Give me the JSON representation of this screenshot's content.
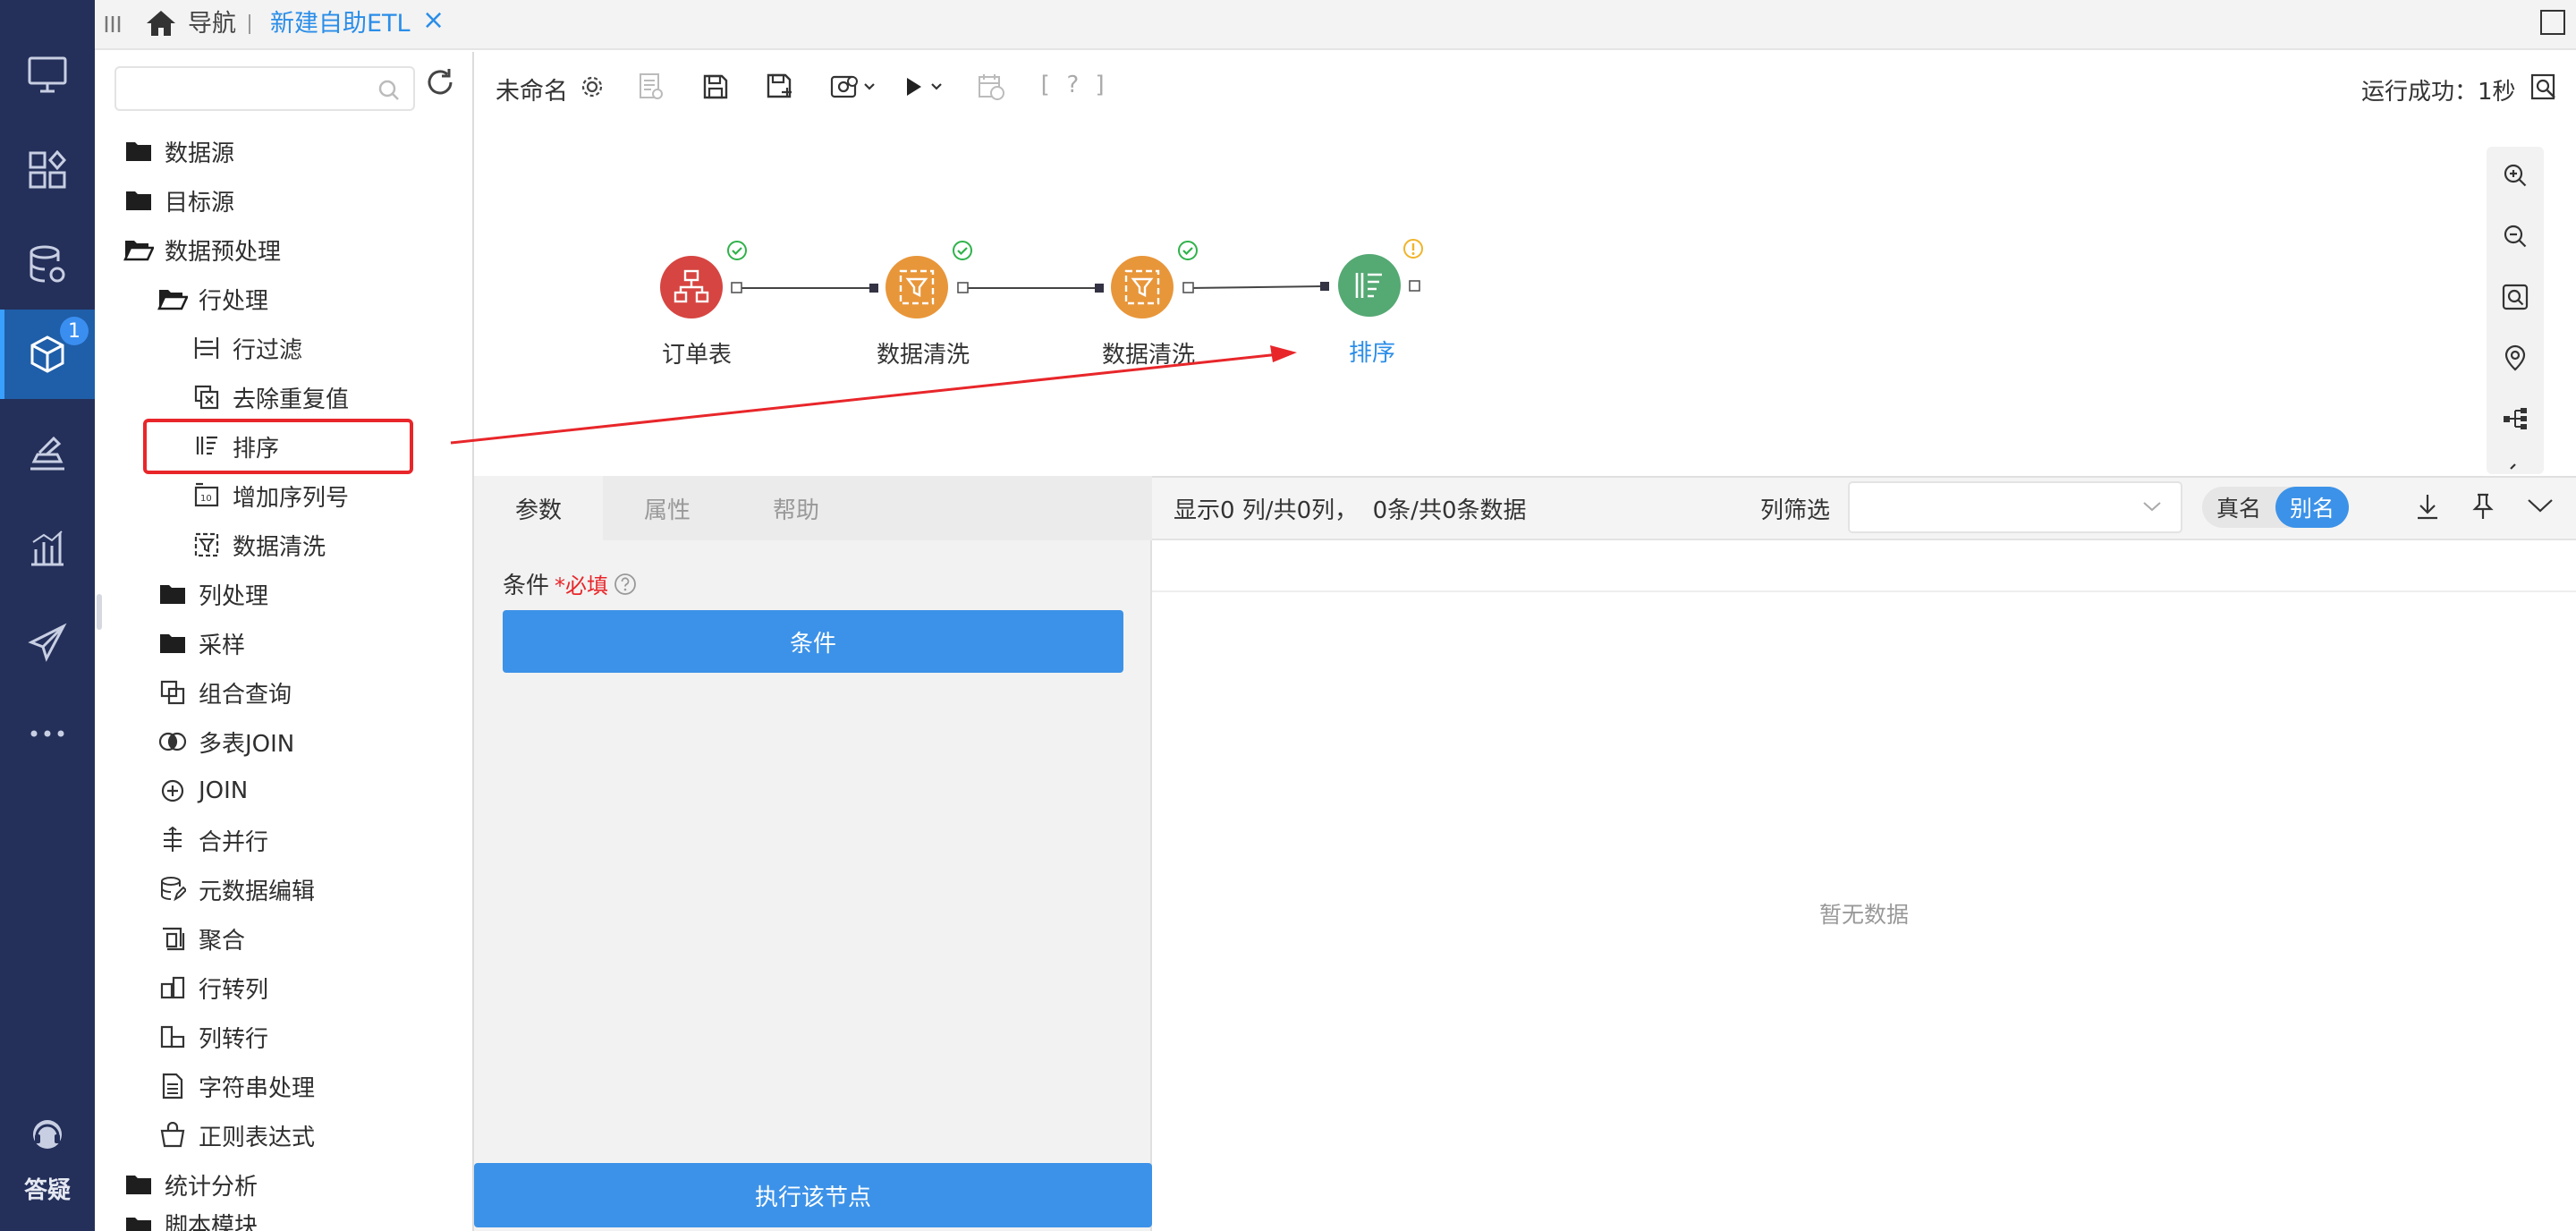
{
  "tabs": {
    "home_label": "导航",
    "active_tab": "新建自助ETL",
    "close_glyph": "×"
  },
  "rail": {
    "badge_count": "1",
    "help_label": "答疑",
    "items": [
      "monitor-icon",
      "dashboard-icon",
      "database-settings-icon",
      "etl-cube-icon",
      "analysis-icon",
      "bar-chart-icon",
      "send-icon",
      "more-icon"
    ]
  },
  "tree": {
    "search_placeholder": "",
    "items": [
      {
        "label": "数据源",
        "icon": "folder-icon"
      },
      {
        "label": "目标源",
        "icon": "folder-icon"
      },
      {
        "label": "数据预处理",
        "icon": "folder-open-icon"
      },
      {
        "label": "行处理",
        "icon": "folder-open-icon"
      },
      {
        "label": "行过滤",
        "icon": "row-filter-icon"
      },
      {
        "label": "去除重复值",
        "icon": "dedupe-icon"
      },
      {
        "label": "排序",
        "icon": "sort-icon"
      },
      {
        "label": "增加序列号",
        "icon": "serial-number-icon"
      },
      {
        "label": "数据清洗",
        "icon": "data-clean-icon"
      },
      {
        "label": "列处理",
        "icon": "folder-icon"
      },
      {
        "label": "采样",
        "icon": "folder-icon"
      },
      {
        "label": "组合查询",
        "icon": "combined-query-icon"
      },
      {
        "label": "多表JOIN",
        "icon": "multi-join-icon"
      },
      {
        "label": "JOIN",
        "icon": "join-icon"
      },
      {
        "label": "合并行",
        "icon": "merge-rows-icon"
      },
      {
        "label": "元数据编辑",
        "icon": "metadata-edit-icon"
      },
      {
        "label": "聚合",
        "icon": "aggregate-icon"
      },
      {
        "label": "行转列",
        "icon": "row-to-column-icon"
      },
      {
        "label": "列转行",
        "icon": "column-to-row-icon"
      },
      {
        "label": "字符串处理",
        "icon": "string-process-icon"
      },
      {
        "label": "正则表达式",
        "icon": "regex-icon"
      },
      {
        "label": "统计分析",
        "icon": "folder-icon"
      },
      {
        "label": "脚本模块",
        "icon": "folder-icon"
      }
    ]
  },
  "toolbar": {
    "doc_name": "未命名",
    "help_label": "[ ? ]",
    "run_status": "运行成功：1秒"
  },
  "flow": {
    "nodes": [
      {
        "label": "订单表",
        "status": "success",
        "color": "#d64541"
      },
      {
        "label": "数据清洗",
        "status": "success",
        "color": "#e8963a"
      },
      {
        "label": "数据清洗",
        "status": "success",
        "color": "#e8963a"
      },
      {
        "label": "排序",
        "status": "warning",
        "color": "#55a973"
      }
    ],
    "selected_node": "排序"
  },
  "params": {
    "tabs": [
      "参数",
      "属性",
      "帮助"
    ],
    "active_tab": "参数",
    "condition_label": "条件",
    "required_mark": "*必填",
    "condition_button": "条件",
    "run_node_button": "执行该节点"
  },
  "data_view": {
    "summary": "显示0 列/共0列，  0条/共0条数据",
    "column_filter_label": "列筛选",
    "column_filter_value": "",
    "toggle_real_name": "真名",
    "toggle_alias": "别名",
    "toggle_selected": "别名",
    "empty_text": "暂无数据"
  },
  "colors": {
    "rail_bg": "#24305a",
    "primary": "#3c92e8",
    "success": "#2fb24a",
    "warning": "#f0b429",
    "annotation": "#e8262a"
  }
}
